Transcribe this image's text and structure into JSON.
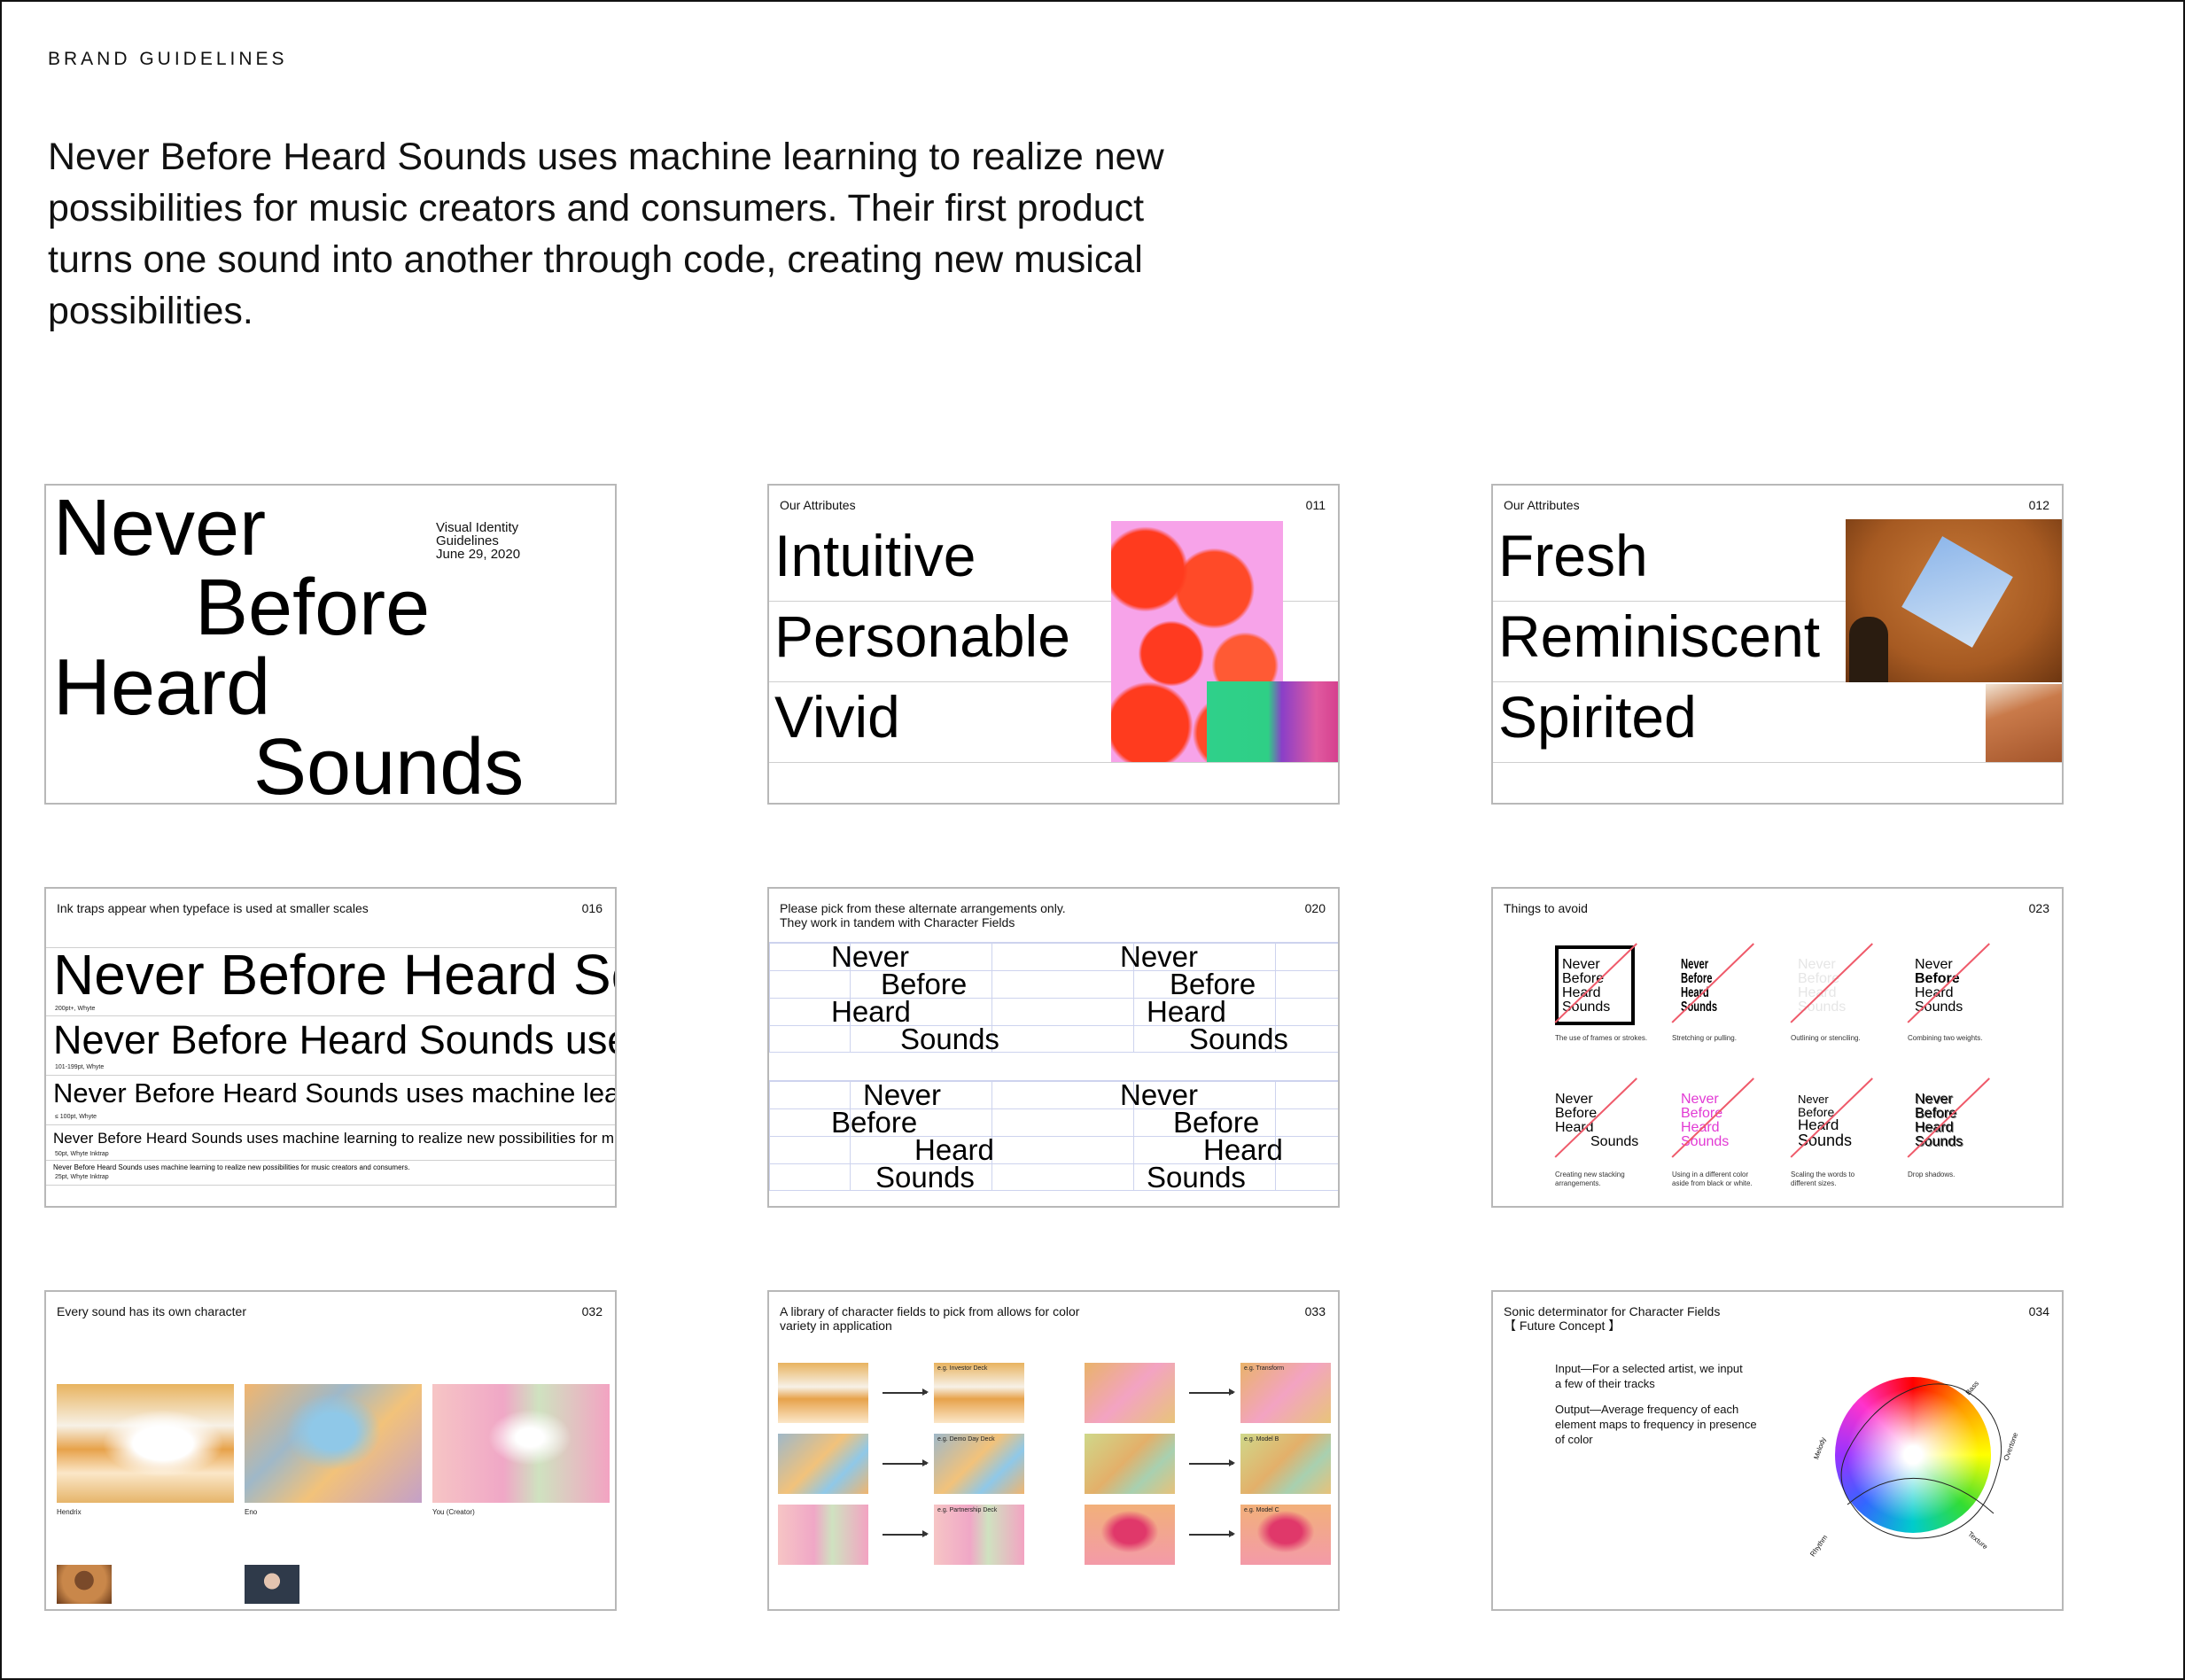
{
  "header": {
    "label": "BRAND GUIDELINES",
    "intro": "Never Before Heard Sounds uses machine learning to realize new possibilities for music creators and consumers. Their first product turns one sound into another through code, creating new musical possibilities."
  },
  "cover": {
    "words": [
      "Never",
      "Before",
      "Heard",
      "Sounds"
    ],
    "meta": [
      "Visual Identity",
      "Guidelines",
      "June 29, 2020"
    ]
  },
  "attributes_1": {
    "title": "Our Attributes",
    "number": "011",
    "words": [
      "Intuitive",
      "Personable",
      "Vivid"
    ]
  },
  "attributes_2": {
    "title": "Our Attributes",
    "number": "012",
    "words": [
      "Fresh",
      "Reminiscent",
      "Spirited"
    ]
  },
  "ink_traps": {
    "title": "Ink traps appear when typeface is used at smaller scales",
    "number": "016",
    "samples": [
      {
        "text": "Never Before Heard Sounds",
        "spec": "200pt+, Whyte"
      },
      {
        "text": "Never Before Heard Sounds uses machine learning",
        "spec": "101-199pt, Whyte"
      },
      {
        "text": "Never Before Heard Sounds uses machine learning to realize",
        "spec": "≤ 100pt, Whyte"
      },
      {
        "text": "Never Before Heard Sounds uses machine learning to realize new possibilities for music creators",
        "spec": "50pt, Whyte Inktrap"
      },
      {
        "text": "Never Before Heard Sounds uses machine learning to realize new possibilities for music creators and consumers.",
        "spec": "25pt, Whyte Inktrap"
      }
    ]
  },
  "arrangements": {
    "title": "Please pick from these alternate arrangements only.",
    "subtitle": "They work in tandem with Character Fields",
    "number": "020",
    "words": [
      "Never",
      "Before",
      "Heard",
      "Sounds"
    ]
  },
  "avoid": {
    "title": "Things to avoid",
    "number": "023",
    "words": [
      "Never",
      "Before",
      "Heard",
      "Sounds"
    ],
    "captions": [
      "The use of frames or strokes.",
      "Stretching or pulling.",
      "Outlining or stenciling.",
      "Combining two weights.",
      "Creating new stacking arrangements.",
      "Using in a different color aside from black or white.",
      "Scaling the words to different sizes.",
      "Drop shadows."
    ],
    "accent": "#e23ad4"
  },
  "character": {
    "title": "Every sound has its own character",
    "number": "032",
    "fields": [
      "Hendrix",
      "Eno",
      "You (Creator)"
    ]
  },
  "library": {
    "title": "A library of character fields to pick from allows for color variety in application",
    "number": "033",
    "examples": [
      "e.g. Investor Deck",
      "e.g. Demo Day Deck",
      "e.g. Partnership Deck",
      "e.g. Transform",
      "e.g. Model B",
      "e.g. Model C"
    ]
  },
  "sonic": {
    "title": "Sonic determinator for Character Fields",
    "subtitle": "【 Future Concept 】",
    "number": "034",
    "input": "Input—For a selected artist, we input a few of their tracks",
    "output": "Output—Average frequency of each element maps to frequency in presence of color",
    "axes": [
      "Bass",
      "Overtone",
      "Texture",
      "Rhythm",
      "Melody"
    ]
  }
}
